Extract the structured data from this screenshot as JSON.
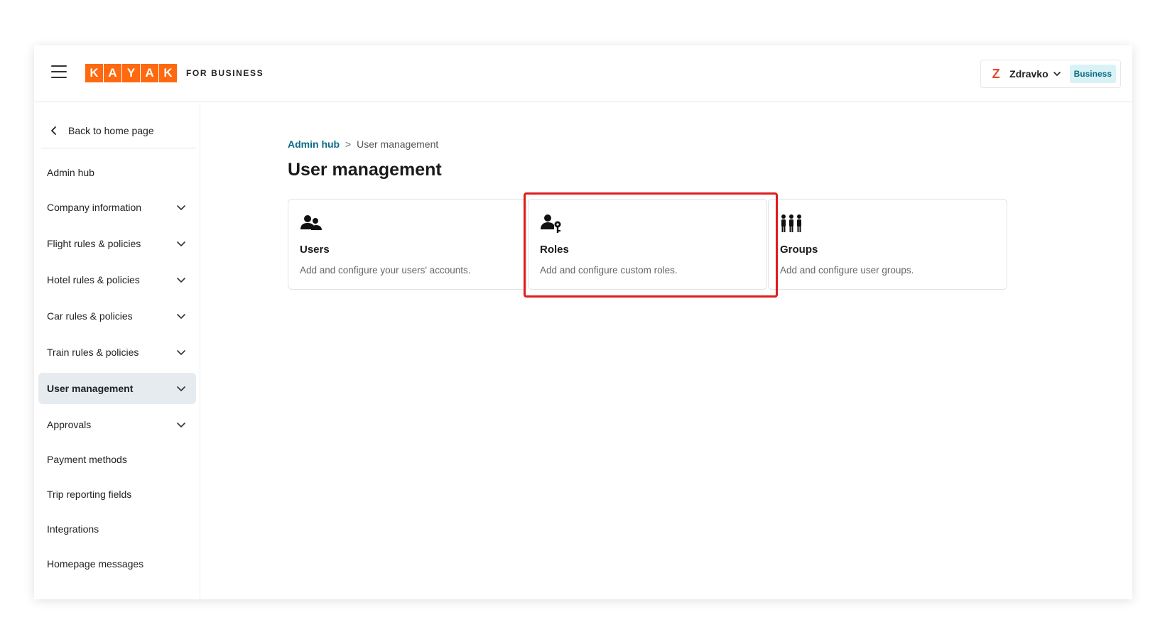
{
  "header": {
    "logo_letters": [
      "K",
      "A",
      "Y",
      "A",
      "K"
    ],
    "logo_suffix": "FOR BUSINESS",
    "account": {
      "avatar_initial": "Z",
      "name": "Zdravko",
      "badge": "Business"
    }
  },
  "sidebar": {
    "back_label": "Back to home page",
    "items": [
      {
        "label": "Admin hub",
        "has_chevron": false,
        "active": false
      },
      {
        "label": "Company information",
        "has_chevron": true,
        "active": false
      },
      {
        "label": "Flight rules & policies",
        "has_chevron": true,
        "active": false
      },
      {
        "label": "Hotel rules & policies",
        "has_chevron": true,
        "active": false
      },
      {
        "label": "Car rules & policies",
        "has_chevron": true,
        "active": false
      },
      {
        "label": "Train rules & policies",
        "has_chevron": true,
        "active": false
      },
      {
        "label": "User management",
        "has_chevron": true,
        "active": true
      },
      {
        "label": "Approvals",
        "has_chevron": true,
        "active": false
      },
      {
        "label": "Payment methods",
        "has_chevron": false,
        "active": false
      },
      {
        "label": "Trip reporting fields",
        "has_chevron": false,
        "active": false
      },
      {
        "label": "Integrations",
        "has_chevron": false,
        "active": false
      },
      {
        "label": "Homepage messages",
        "has_chevron": false,
        "active": false
      }
    ]
  },
  "main": {
    "breadcrumb": {
      "link": "Admin hub",
      "separator": ">",
      "current": "User management"
    },
    "title": "User management",
    "cards": [
      {
        "icon": "users-icon",
        "title": "Users",
        "description": "Add and configure your users' accounts."
      },
      {
        "icon": "user-key-icon",
        "title": "Roles",
        "description": "Add and configure custom roles."
      },
      {
        "icon": "group-icon",
        "title": "Groups",
        "description": "Add and configure user groups."
      }
    ]
  },
  "colors": {
    "brand": "#ff690f",
    "link": "#0a6b85",
    "highlight": "#e01b1b",
    "active_bg": "#e6ebf0"
  }
}
